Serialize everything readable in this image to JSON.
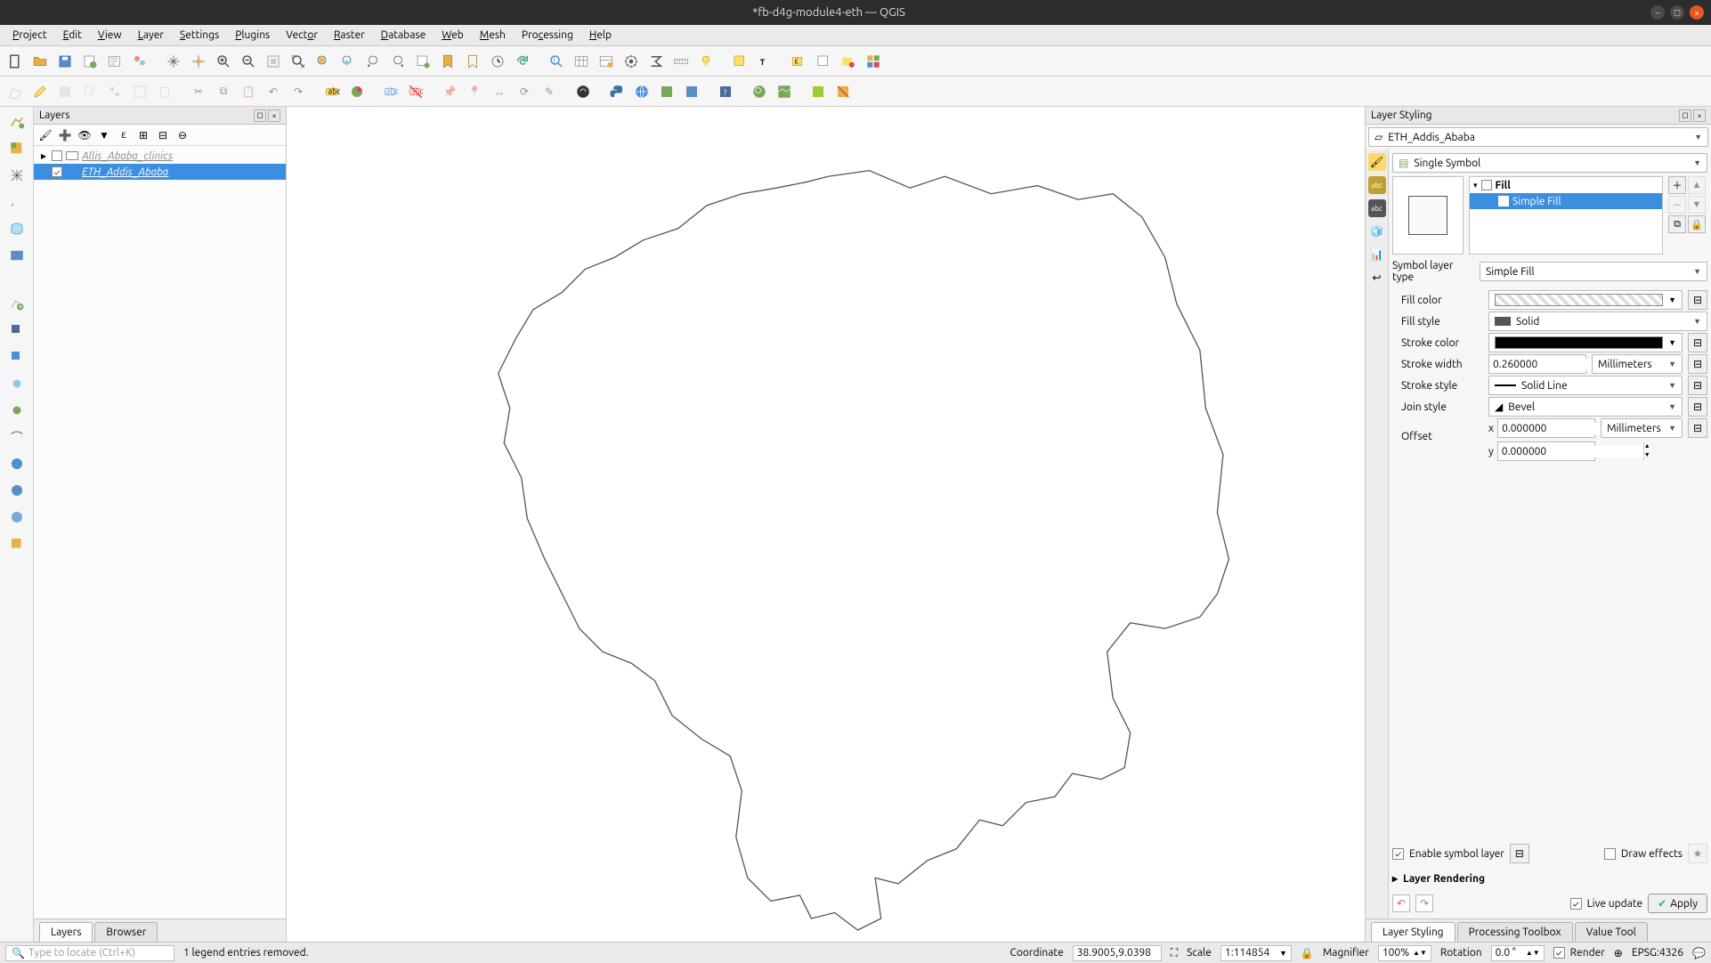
{
  "title": "*fb-d4g-module4-eth — QGIS",
  "menu": [
    "Project",
    "Edit",
    "View",
    "Layer",
    "Settings",
    "Plugins",
    "Vector",
    "Raster",
    "Database",
    "Web",
    "Mesh",
    "Processing",
    "Help"
  ],
  "layers_panel": {
    "title": "Layers",
    "items": [
      {
        "name": "Allis_Ababa_clinics",
        "checked": false,
        "selected": false,
        "disabled": true
      },
      {
        "name": "ETH_Addis_Ababa",
        "checked": true,
        "selected": true,
        "disabled": false
      }
    ],
    "tabs": [
      "Layers",
      "Browser"
    ]
  },
  "styling": {
    "title": "Layer Styling",
    "layer": "ETH_Addis_Ababa",
    "symbol_mode": "Single Symbol",
    "tree": [
      {
        "label": "Fill",
        "bold": true,
        "selected": false
      },
      {
        "label": "Simple Fill",
        "bold": false,
        "selected": true
      }
    ],
    "symbol_layer_type_label": "Symbol layer type",
    "symbol_layer_type": "Simple Fill",
    "props": {
      "fill_color_label": "Fill color",
      "fill_style_label": "Fill style",
      "fill_style": "Solid",
      "stroke_color_label": "Stroke color",
      "stroke_width_label": "Stroke width",
      "stroke_width": "0.260000",
      "stroke_width_unit": "Millimeters",
      "stroke_style_label": "Stroke style",
      "stroke_style": "Solid Line",
      "join_style_label": "Join style",
      "join_style": "Bevel",
      "offset_label": "Offset",
      "offset_x_label": "x",
      "offset_x": "0.000000",
      "offset_y_label": "y",
      "offset_y": "0.000000",
      "offset_unit": "Millimeters"
    },
    "enable_symbol_layer_label": "Enable symbol layer",
    "enable_symbol_layer": true,
    "draw_effects_label": "Draw effects",
    "draw_effects": false,
    "layer_rendering_label": "Layer Rendering",
    "live_update_label": "Live update",
    "live_update": true,
    "apply_label": "Apply",
    "bottom_tabs": [
      "Layer Styling",
      "Processing Toolbox",
      "Value Tool"
    ]
  },
  "status": {
    "locator_placeholder": "Type to locate (Ctrl+K)",
    "message": "1 legend entries removed.",
    "coord_label": "Coordinate",
    "coord": "38.9005,9.0398",
    "scale_label": "Scale",
    "scale": "1:114854",
    "magnifier_label": "Magnifier",
    "magnifier": "100%",
    "rotation_label": "Rotation",
    "rotation": "0.0 °",
    "render_label": "Render",
    "render": true,
    "crs": "EPSG:4326"
  }
}
